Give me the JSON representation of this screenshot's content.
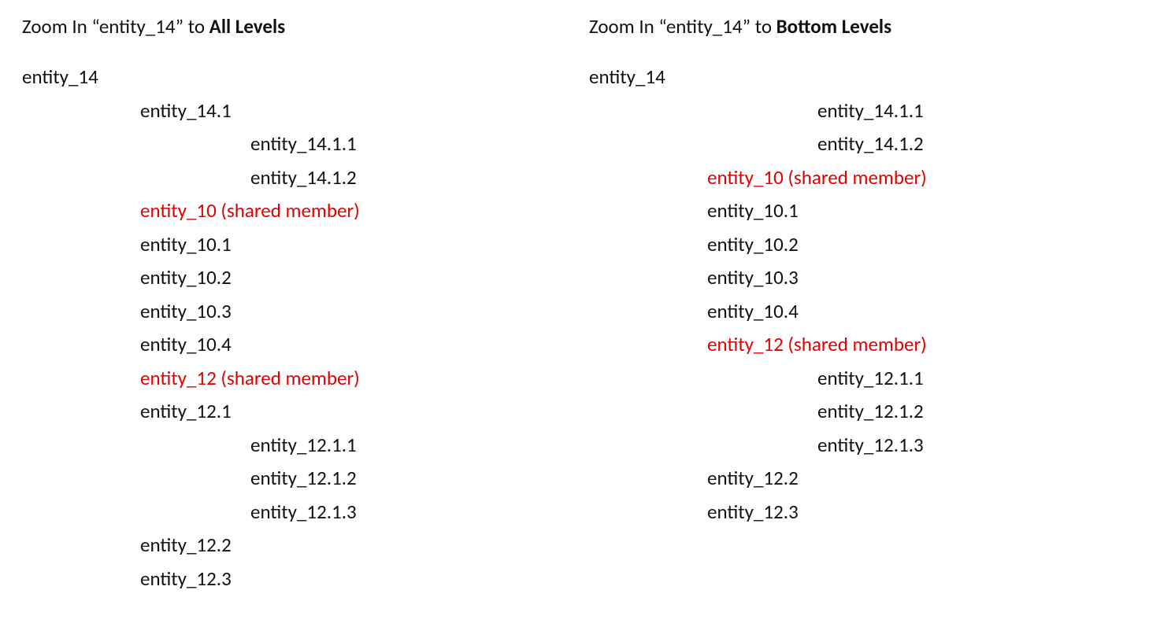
{
  "left": {
    "heading_pre": "Zoom In “entity_14” to ",
    "heading_bold": "All Levels",
    "items": [
      {
        "label": "entity_14",
        "indent": 0,
        "shared": false
      },
      {
        "label": "entity_14.1",
        "indent": 1,
        "shared": false
      },
      {
        "label": "entity_14.1.1",
        "indent": 2,
        "shared": false
      },
      {
        "label": "entity_14.1.2",
        "indent": 2,
        "shared": false
      },
      {
        "label": "entity_10 (shared member)",
        "indent": 1,
        "shared": true
      },
      {
        "label": "entity_10.1",
        "indent": 1,
        "shared": false
      },
      {
        "label": "entity_10.2",
        "indent": 1,
        "shared": false
      },
      {
        "label": "entity_10.3",
        "indent": 1,
        "shared": false
      },
      {
        "label": "entity_10.4",
        "indent": 1,
        "shared": false
      },
      {
        "label": "entity_12 (shared member)",
        "indent": 1,
        "shared": true
      },
      {
        "label": "entity_12.1",
        "indent": 1,
        "shared": false
      },
      {
        "label": "entity_12.1.1",
        "indent": 2,
        "shared": false
      },
      {
        "label": "entity_12.1.2",
        "indent": 2,
        "shared": false
      },
      {
        "label": "entity_12.1.3",
        "indent": 2,
        "shared": false
      },
      {
        "label": "entity_12.2",
        "indent": 1,
        "shared": false
      },
      {
        "label": "entity_12.3",
        "indent": 1,
        "shared": false
      }
    ]
  },
  "right": {
    "heading_pre": "Zoom In “entity_14” to ",
    "heading_bold": "Bottom Levels",
    "items": [
      {
        "label": "entity_14",
        "indent": 0,
        "shared": false
      },
      {
        "label": "entity_14.1.1",
        "indent": 2,
        "shared": false
      },
      {
        "label": "entity_14.1.2",
        "indent": 2,
        "shared": false
      },
      {
        "label": "entity_10 (shared member)",
        "indent": 1,
        "shared": true
      },
      {
        "label": "entity_10.1",
        "indent": 1,
        "shared": false
      },
      {
        "label": "entity_10.2",
        "indent": 1,
        "shared": false
      },
      {
        "label": "entity_10.3",
        "indent": 1,
        "shared": false
      },
      {
        "label": "entity_10.4",
        "indent": 1,
        "shared": false
      },
      {
        "label": "entity_12 (shared member)",
        "indent": 1,
        "shared": true
      },
      {
        "label": "entity_12.1.1",
        "indent": 2,
        "shared": false
      },
      {
        "label": "entity_12.1.2",
        "indent": 2,
        "shared": false
      },
      {
        "label": "entity_12.1.3",
        "indent": 2,
        "shared": false
      },
      {
        "label": "entity_12.2",
        "indent": 1,
        "shared": false
      },
      {
        "label": "entity_12.3",
        "indent": 1,
        "shared": false
      }
    ]
  }
}
